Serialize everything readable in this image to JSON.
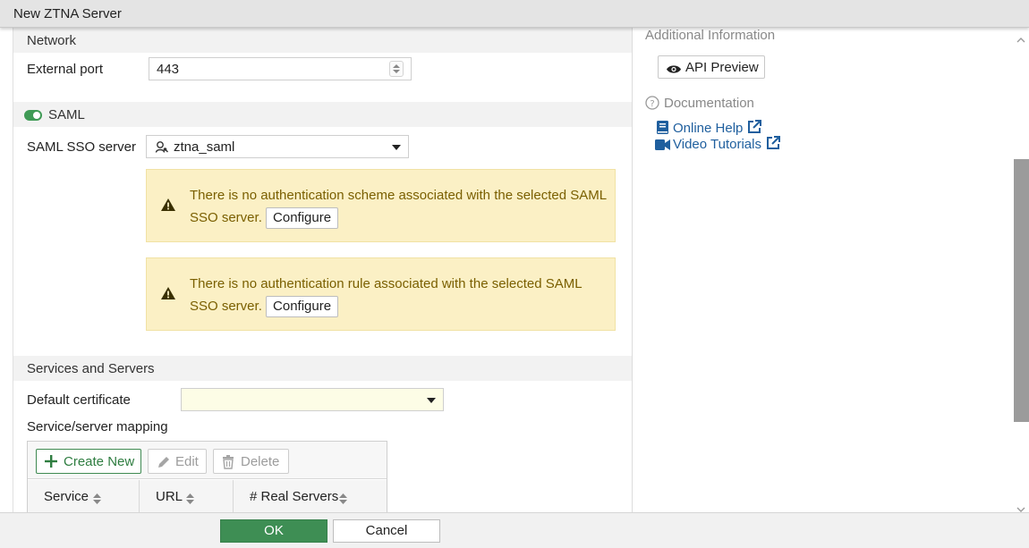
{
  "window": {
    "title": "New ZTNA Server"
  },
  "network": {
    "section_title": "Network",
    "external_port_label": "External port",
    "external_port_value": "443"
  },
  "saml": {
    "section_title": "SAML",
    "enabled": true,
    "sso_server_label": "SAML SSO server",
    "sso_server_value": "ztna_saml",
    "warnings": [
      {
        "message": "There is no authentication scheme associated with the selected SAML SSO server.",
        "button_label": "Configure"
      },
      {
        "message": "There is no authentication rule associated with the selected SAML SSO server.",
        "button_label": "Configure"
      }
    ]
  },
  "services": {
    "section_title": "Services and Servers",
    "default_certificate_label": "Default certificate",
    "default_certificate_value": "",
    "mapping_label": "Service/server mapping",
    "toolbar": {
      "create_label": "Create New",
      "edit_label": "Edit",
      "delete_label": "Delete"
    },
    "columns": [
      "Service",
      "URL",
      "# Real Servers"
    ]
  },
  "sidebar": {
    "additional_info_title": "Additional Information",
    "api_preview_label": "API Preview",
    "documentation_title": "Documentation",
    "links": [
      {
        "label": "Online Help"
      },
      {
        "label": "Video Tutorials"
      }
    ]
  },
  "footer": {
    "ok_label": "OK",
    "cancel_label": "Cancel"
  },
  "colors": {
    "accent_green": "#3e8e54",
    "warning_bg": "#fbf0c5",
    "warning_text": "#7a5f00",
    "link_blue": "#1f5f9e",
    "field_highlight": "#fdfde6"
  },
  "icons": {
    "saml_server": "person-key-icon",
    "warning": "warning-triangle-icon",
    "create": "plus-icon",
    "edit": "pencil-icon",
    "delete": "trash-icon",
    "sort": "sort-icon",
    "api_preview": "eye-icon",
    "documentation": "question-circle-icon",
    "online_help": "book-icon",
    "video": "video-camera-icon",
    "external_link": "external-link-icon"
  }
}
